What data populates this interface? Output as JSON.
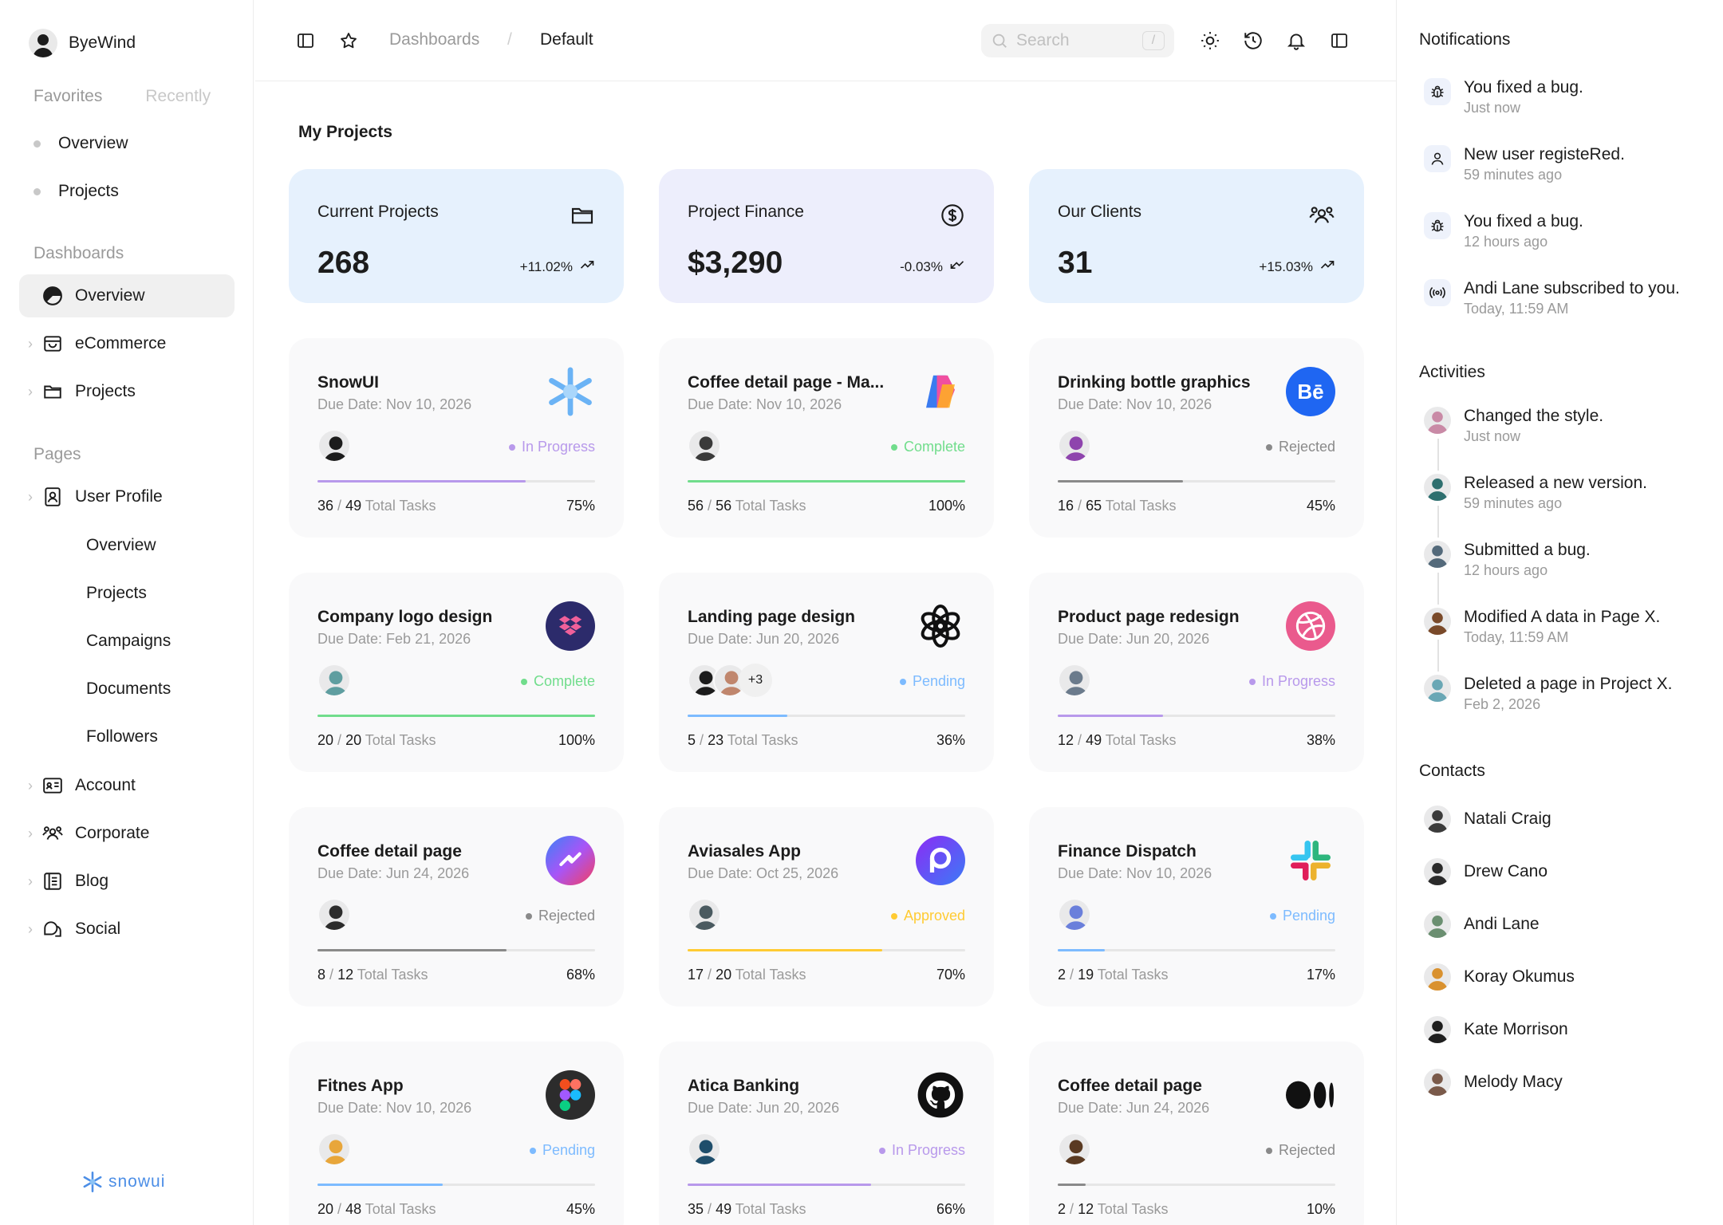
{
  "brand": {
    "name": "ByeWind"
  },
  "sidebar": {
    "tabs": [
      "Favorites",
      "Recently"
    ],
    "favorites": [
      "Overview",
      "Projects"
    ],
    "dashboards_title": "Dashboards",
    "dashboards": [
      {
        "label": "Overview",
        "active": true
      },
      {
        "label": "eCommerce"
      },
      {
        "label": "Projects"
      }
    ],
    "pages_title": "Pages",
    "user_profile": "User Profile",
    "user_profile_sub": [
      "Overview",
      "Projects",
      "Campaigns",
      "Documents",
      "Followers"
    ],
    "pages": [
      "Account",
      "Corporate",
      "Blog",
      "Social"
    ],
    "logo_text": "snowui"
  },
  "topbar": {
    "crumb1": "Dashboards",
    "separator": "/",
    "crumb2": "Default",
    "search_placeholder": "Search",
    "search_shortcut": "/"
  },
  "main": {
    "title": "My Projects",
    "stats": [
      {
        "label": "Current Projects",
        "value": "268",
        "change": "+11.02%",
        "trend": "up",
        "bg": "#e6f1fd",
        "icon": "folder-icon"
      },
      {
        "label": "Project Finance",
        "value": "$3,290",
        "change": "-0.03%",
        "trend": "down",
        "bg": "#edeefc",
        "icon": "dollar-icon"
      },
      {
        "label": "Our Clients",
        "value": "31",
        "change": "+15.03%",
        "trend": "up",
        "bg": "#e6f1fd",
        "icon": "users-icon"
      }
    ],
    "projects": [
      {
        "title": "SnowUI",
        "due": "Due Date: Nov 10, 2026",
        "status": "In Progress",
        "status_color": "#b899eb",
        "done": "36",
        "total": "49",
        "tasks_label": "Total Tasks",
        "percent": "75%",
        "progress": 0.75,
        "logo": "snowflake",
        "avatars": [
          "#1c1c1c"
        ]
      },
      {
        "title": "Coffee detail page - Ma...",
        "due": "Due Date: Nov 10, 2026",
        "status": "Complete",
        "status_color": "#71dd8c",
        "done": "56",
        "total": "56",
        "tasks_label": "Total Tasks",
        "percent": "100%",
        "progress": 1.0,
        "logo": "copilot",
        "avatars": [
          "#3a3a3a"
        ]
      },
      {
        "title": "Drinking bottle graphics",
        "due": "Due Date: Nov 10, 2026",
        "status": "Rejected",
        "status_color": "#8a8a8a",
        "done": "16",
        "total": "65",
        "tasks_label": "Total Tasks",
        "percent": "45%",
        "progress": 0.45,
        "logo": "behance",
        "avatars": [
          "#8e44ad"
        ]
      },
      {
        "title": "Company logo design",
        "due": "Due Date: Feb 21, 2026",
        "status": "Complete",
        "status_color": "#71dd8c",
        "done": "20",
        "total": "20",
        "tasks_label": "Total Tasks",
        "percent": "100%",
        "progress": 1.0,
        "logo": "dropbox",
        "avatars": [
          "#5f9ea0"
        ]
      },
      {
        "title": "Landing page design",
        "due": "Due Date: Jun 20, 2026",
        "status": "Pending",
        "status_color": "#7dbbff",
        "done": "5",
        "total": "23",
        "tasks_label": "Total Tasks",
        "percent": "36%",
        "progress": 0.36,
        "logo": "openai",
        "avatars": [
          "#1c1c1c",
          "#c0866d"
        ],
        "more": "+3"
      },
      {
        "title": "Product page redesign",
        "due": "Due Date: Jun 20, 2026",
        "status": "In Progress",
        "status_color": "#b899eb",
        "done": "12",
        "total": "49",
        "tasks_label": "Total Tasks",
        "percent": "38%",
        "progress": 0.38,
        "logo": "dribbble",
        "avatars": [
          "#6b7b8c"
        ]
      },
      {
        "title": "Coffee detail page",
        "due": "Due Date: Jun 24, 2026",
        "status": "Rejected",
        "status_color": "#8a8a8a",
        "done": "8",
        "total": "12",
        "tasks_label": "Total Tasks",
        "percent": "68%",
        "progress": 0.68,
        "logo": "messenger",
        "avatars": [
          "#2c2c2c"
        ]
      },
      {
        "title": "Aviasales App",
        "due": "Due Date: Oct 25, 2026",
        "status": "Approved",
        "status_color": "#ffcb33",
        "done": "17",
        "total": "20",
        "tasks_label": "Total Tasks",
        "percent": "70%",
        "progress": 0.7,
        "logo": "aviasales",
        "avatars": [
          "#4a5a60"
        ]
      },
      {
        "title": "Finance Dispatch",
        "due": "Due Date: Nov 10, 2026",
        "status": "Pending",
        "status_color": "#7dbbff",
        "done": "2",
        "total": "19",
        "tasks_label": "Total Tasks",
        "percent": "17%",
        "progress": 0.17,
        "logo": "slack",
        "avatars": [
          "#6a7fdb"
        ]
      },
      {
        "title": "Fitnes App",
        "due": "Due Date: Nov 10, 2026",
        "status": "Pending",
        "status_color": "#7dbbff",
        "done": "20",
        "total": "48",
        "tasks_label": "Total Tasks",
        "percent": "45%",
        "progress": 0.45,
        "logo": "figma",
        "avatars": [
          "#e8a63a"
        ]
      },
      {
        "title": "Atica Banking",
        "due": "Due Date: Jun 20, 2026",
        "status": "In Progress",
        "status_color": "#b899eb",
        "done": "35",
        "total": "49",
        "tasks_label": "Total Tasks",
        "percent": "66%",
        "progress": 0.66,
        "logo": "github",
        "avatars": [
          "#1f4e6b"
        ]
      },
      {
        "title": "Coffee detail page",
        "due": "Due Date: Jun 24, 2026",
        "status": "Rejected",
        "status_color": "#8a8a8a",
        "done": "2",
        "total": "12",
        "tasks_label": "Total Tasks",
        "percent": "10%",
        "progress": 0.1,
        "logo": "medium",
        "avatars": [
          "#5a3a22"
        ]
      }
    ]
  },
  "rightpanel": {
    "notifications_title": "Notifications",
    "notifications": [
      {
        "text": "You fixed a bug.",
        "time": "Just now",
        "icon": "bug-icon"
      },
      {
        "text": "New user registeRed.",
        "time": "59 minutes ago",
        "icon": "user-icon"
      },
      {
        "text": "You fixed a bug.",
        "time": "12 hours ago",
        "icon": "bug-icon"
      },
      {
        "text": "Andi Lane subscribed to you.",
        "time": "Today, 11:59 AM",
        "icon": "broadcast-icon"
      }
    ],
    "activities_title": "Activities",
    "activities": [
      {
        "text": "Changed the style.",
        "time": "Just now",
        "color": "#c98aa6"
      },
      {
        "text": "Released a new version.",
        "time": "59 minutes ago",
        "color": "#2e6f6f"
      },
      {
        "text": "Submitted a bug.",
        "time": "12 hours ago",
        "color": "#546a7b"
      },
      {
        "text": "Modified A data in Page X.",
        "time": "Today, 11:59 AM",
        "color": "#7a4a2a"
      },
      {
        "text": "Deleted a page in Project X.",
        "time": "Feb 2, 2026",
        "color": "#6aa7b5"
      }
    ],
    "contacts_title": "Contacts",
    "contacts": [
      {
        "name": "Natali Craig",
        "color": "#3b3b3b"
      },
      {
        "name": "Drew Cano",
        "color": "#2b2b2b"
      },
      {
        "name": "Andi Lane",
        "color": "#6b8f71"
      },
      {
        "name": "Koray Okumus",
        "color": "#d9912f"
      },
      {
        "name": "Kate Morrison",
        "color": "#1f1f1f"
      },
      {
        "name": "Melody Macy",
        "color": "#7a5a4a"
      }
    ]
  }
}
